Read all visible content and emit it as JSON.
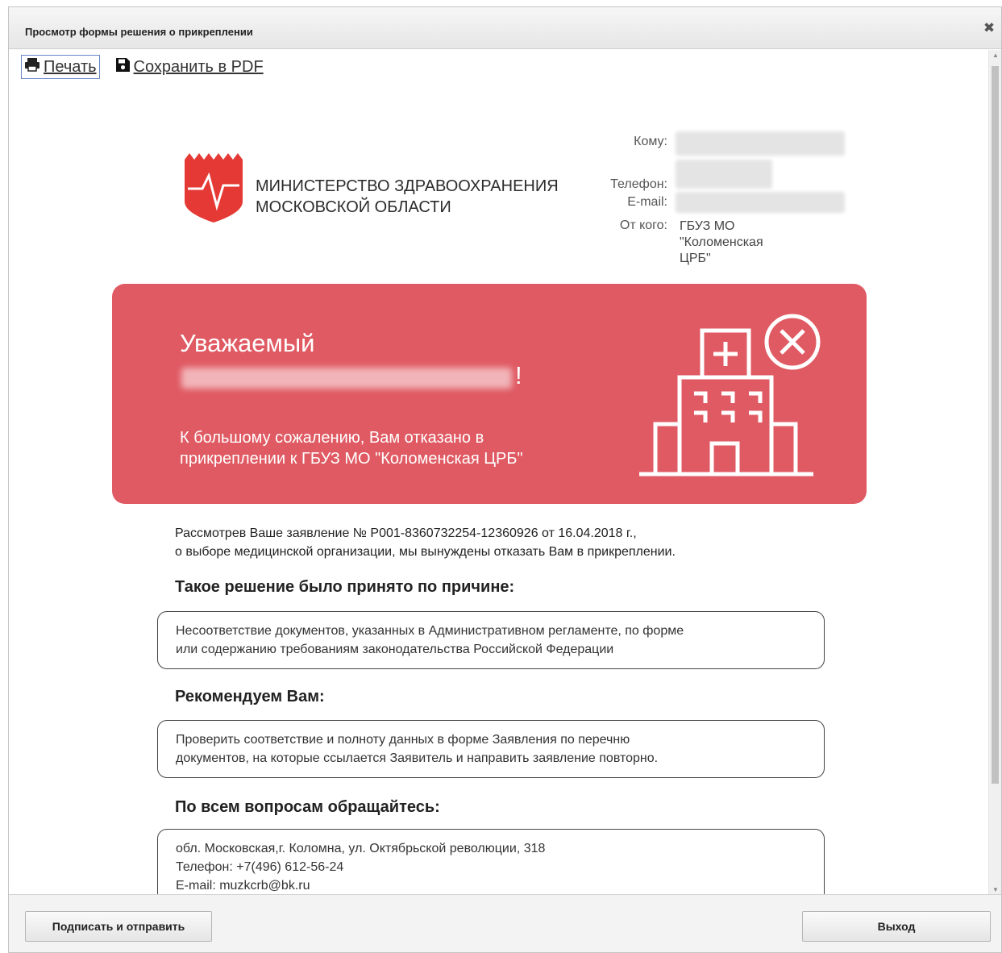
{
  "window": {
    "title": "Просмотр формы решения о прикреплении"
  },
  "toolbar": {
    "print_label": "Печать",
    "save_pdf_label": "Сохранить в PDF"
  },
  "header": {
    "ministry_line1": "МИНИСТЕРСТВО ЗДРАВООХРАНЕНИЯ",
    "ministry_line2": "МОСКОВСКОЙ ОБЛАСТИ",
    "to_label": "Кому:",
    "phone_label": "Телефон:",
    "email_label": "E-mail:",
    "from_label": "От кого:",
    "from_value_line1": "ГБУЗ МО \"Коломенская",
    "from_value_line2": "ЦРБ\""
  },
  "banner": {
    "greeting": "Уважаемый",
    "exclamation": "!",
    "message_line1": "К большому сожалению, Вам отказано в",
    "message_line2": "прикреплении к ГБУЗ МО \"Коломенская ЦРБ\""
  },
  "body": {
    "intro_line1": "Рассмотрев Ваше заявление № P001-8360732254-12360926 от 16.04.2018 г.,",
    "intro_line2": "о выборе медицинской организации, мы вынуждены отказать Вам в прикреплении.",
    "reason_heading": "Такое решение было принято по причине:",
    "reason_line1": "Несоответствие документов, указанных в Административном регламенте, по форме",
    "reason_line2": "или содержанию требованиям законодательства Российской Федерации",
    "recommend_heading": "Рекомендуем Вам:",
    "recommend_line1": "Проверить соответствие и полноту данных в форме Заявления по перечню",
    "recommend_line2": "документов, на которые ссылается Заявитель и направить заявление повторно.",
    "contact_heading": "По всем вопросам обращайтесь:",
    "contact_address": "обл. Московская,г. Коломна, ул. Октябрьской революции, 318",
    "contact_phone": "Телефон: +7(496) 612-56-24",
    "contact_email": "E-mail: muzkcrb@bk.ru"
  },
  "footer": {
    "sign_send_label": "Подписать и отправить",
    "exit_label": "Выход"
  },
  "colors": {
    "banner": "#e05a63",
    "logo_red": "#e53935",
    "border": "#444444"
  },
  "icons": [
    "close-icon",
    "printer-icon",
    "floppy-disk-icon",
    "ministry-shield-logo",
    "hospital-reject-icon"
  ]
}
